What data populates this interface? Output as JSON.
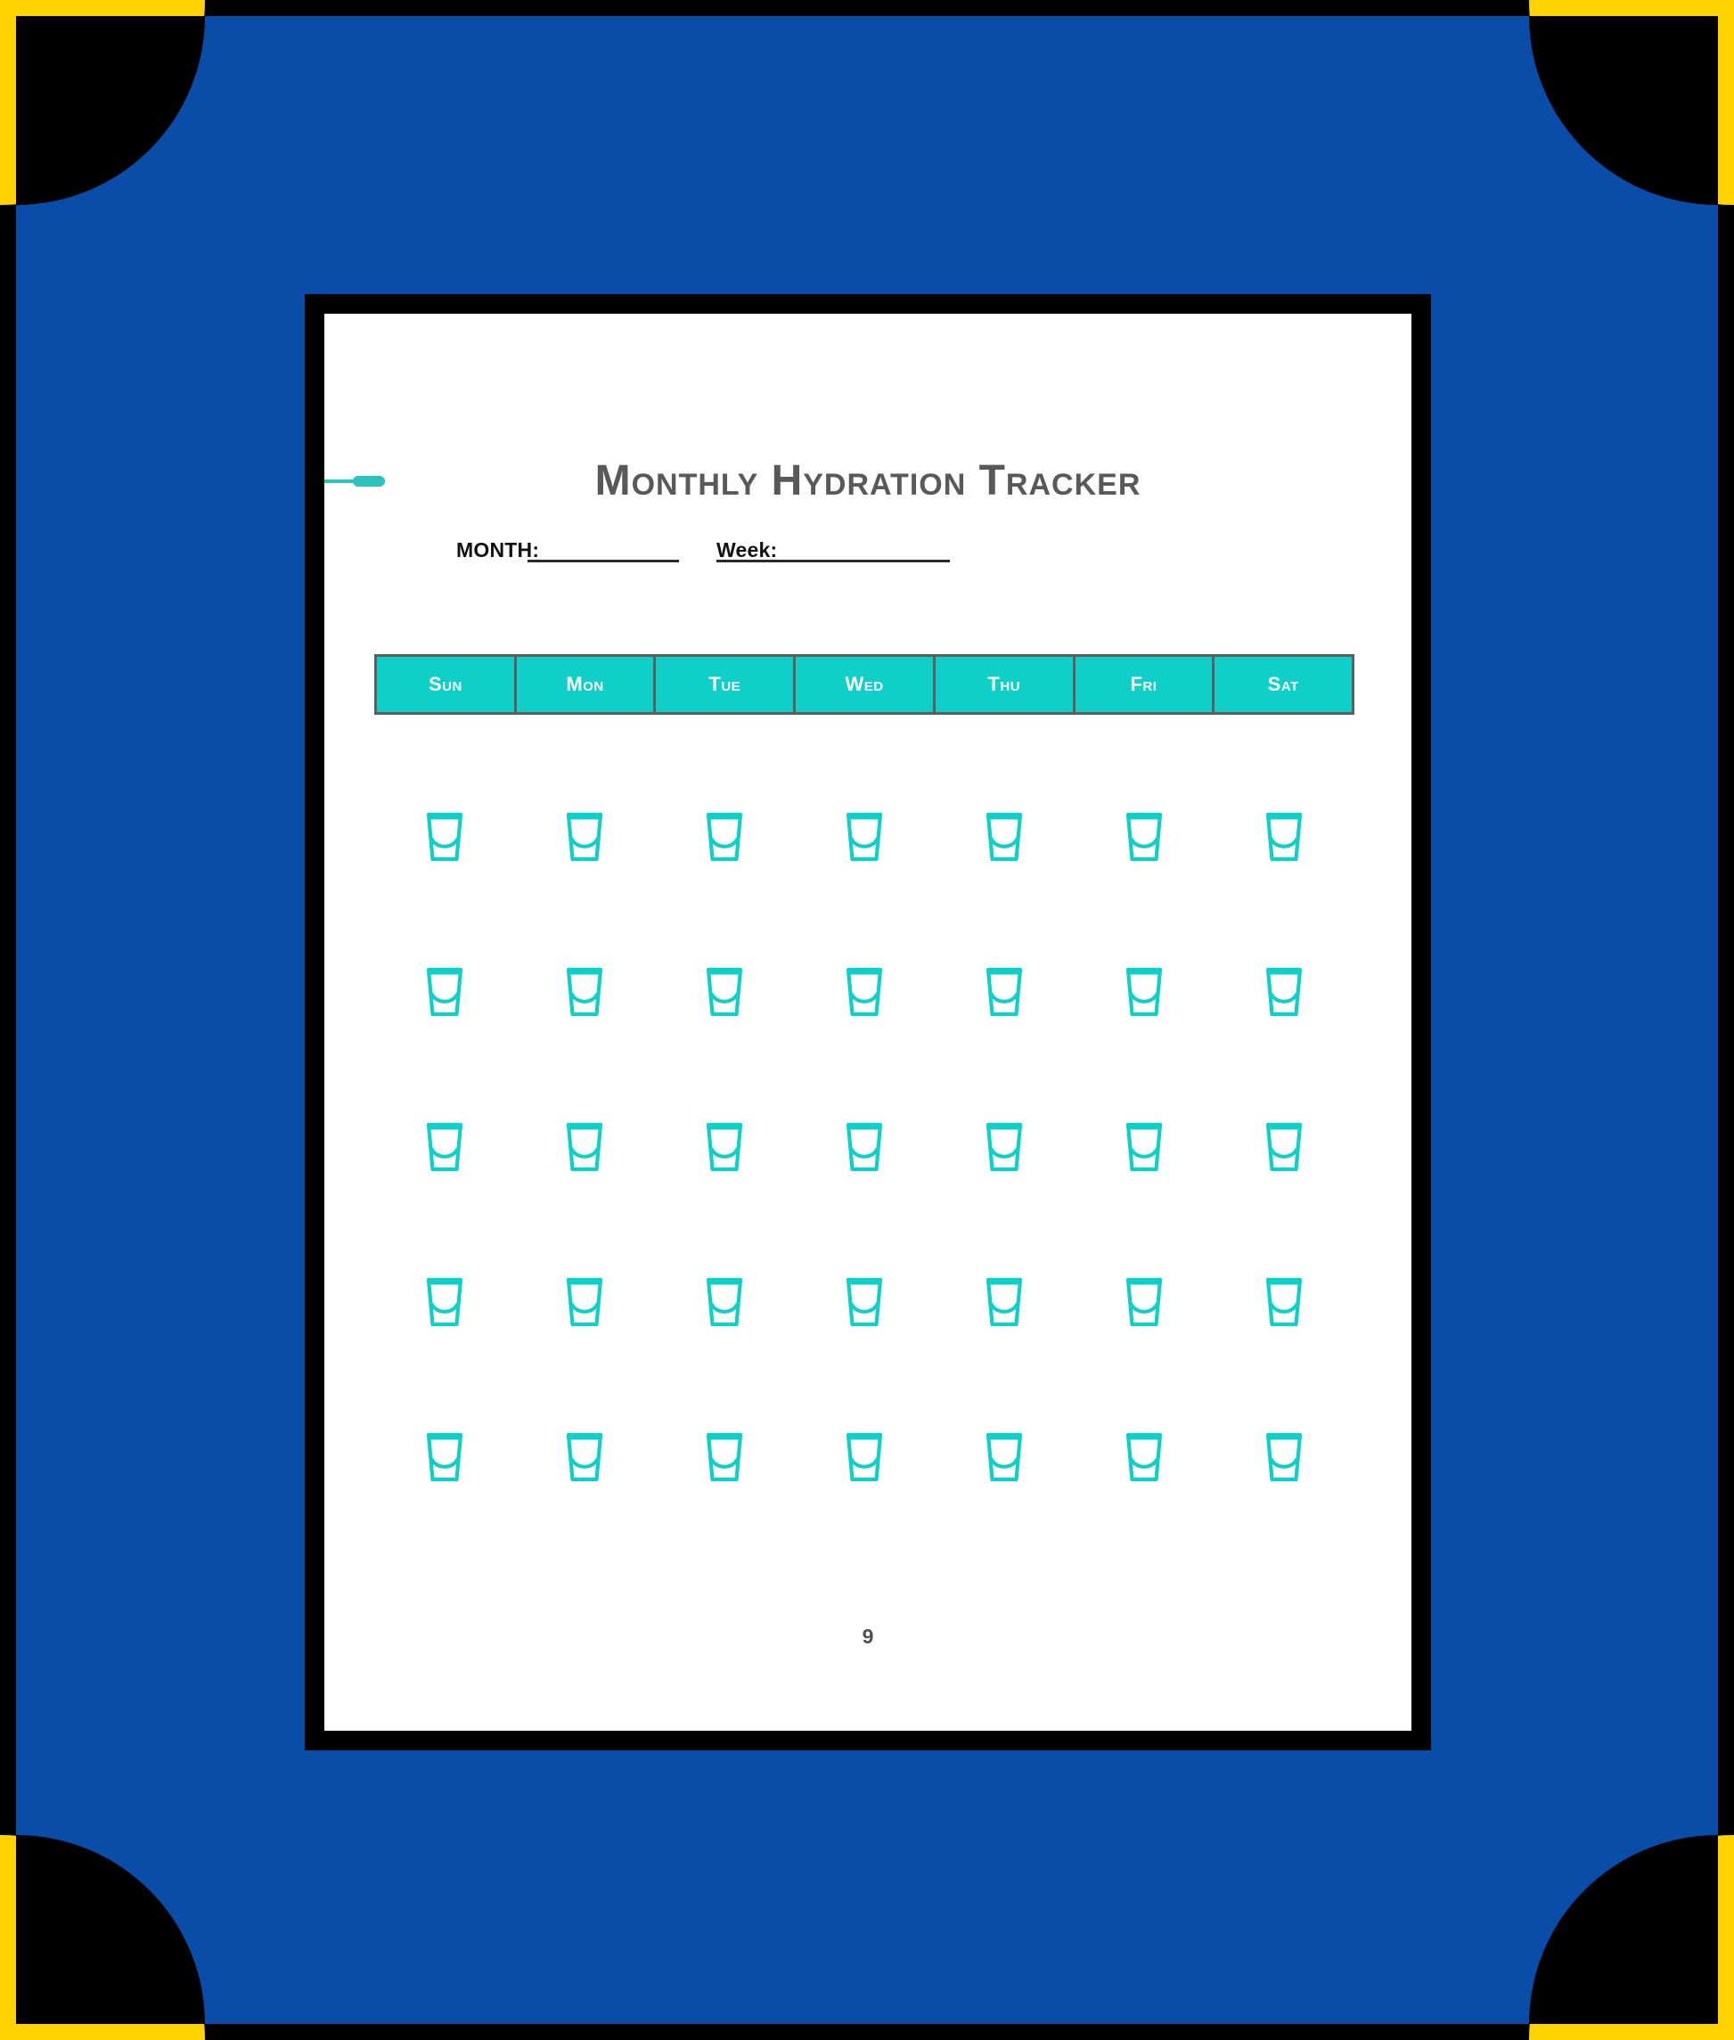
{
  "worksheet": {
    "title": "Monthly Hydration Tracker",
    "page_number": "9",
    "accent_color": "#2BC4BC",
    "header_color": "#0FCFC9",
    "glass_color": "#0FCFC9",
    "title_color": "#595959",
    "fields": [
      {
        "id": "month",
        "label": "MONTH:",
        "value": ""
      },
      {
        "id": "week",
        "label": "Week:",
        "value": ""
      }
    ],
    "weekdays": [
      "Sun",
      "Mon",
      "Tue",
      "Wed",
      "Thu",
      "Fri",
      "Sat"
    ],
    "grid": {
      "rows": 5,
      "columns": 7,
      "total_cells": 35,
      "icon": "water-glass-icon",
      "filled": false
    }
  },
  "decor": {
    "background_color": "#0A4DA8",
    "corner_color": "#FFD300",
    "frame_color": "#000000",
    "page_color": "#FFFFFF"
  }
}
